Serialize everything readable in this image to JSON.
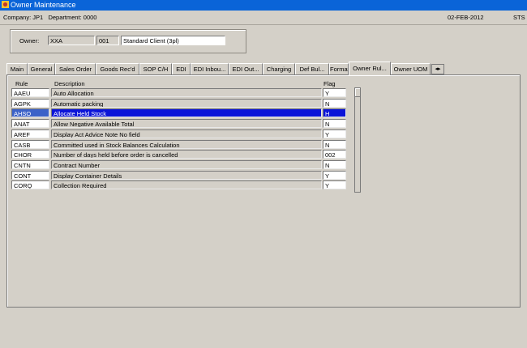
{
  "window": {
    "title": "Owner Maintenance",
    "icon": "oracle-forms-app-icon"
  },
  "infobar": {
    "company": "Company: JP1   Department: 0000",
    "date": "02-FEB-2012",
    "user": "STS"
  },
  "owner": {
    "label": "Owner:",
    "code": "XXA",
    "number": "001",
    "name": "Standard Client (3pl)"
  },
  "tabs": [
    {
      "label": "Main"
    },
    {
      "label": "General"
    },
    {
      "label": "Sales Order"
    },
    {
      "label": "Goods Rec'd"
    },
    {
      "label": "SOP C/H"
    },
    {
      "label": "EDI"
    },
    {
      "label": "EDI Inbou..."
    },
    {
      "label": "EDI Out..."
    },
    {
      "label": "Charging"
    },
    {
      "label": "Def Bul..."
    },
    {
      "label": "Format"
    },
    {
      "label": "Owner Rul..."
    },
    {
      "label": "Owner UOM"
    }
  ],
  "active_tab": "Owner Rul...",
  "tab_scroll_glyph": "◂▸",
  "grid": {
    "columns": {
      "rule": "Rule",
      "description": "Description",
      "flag": "Flag"
    },
    "rows": [
      {
        "rule": "AAEU",
        "description": "Auto Allocation",
        "flag": "Y"
      },
      {
        "rule": "AGPK",
        "description": "Automatic packing",
        "flag": "N"
      },
      {
        "rule": "AHSO",
        "description": "Allocate Held Stock",
        "flag": "H"
      },
      {
        "rule": "ANAT",
        "description": "Allow Negative Available Total",
        "flag": "N"
      },
      {
        "rule": "AREF",
        "description": "Display Act Advice Note No field",
        "flag": "Y"
      },
      {
        "rule": "CASB",
        "description": "Committed used in Stock Balances Calculation",
        "flag": "N"
      },
      {
        "rule": "CHOR",
        "description": "Number of days held before order is cancelled",
        "flag": "002"
      },
      {
        "rule": "CNTN",
        "description": "Contract Number",
        "flag": "N"
      },
      {
        "rule": "CONT",
        "description": "Display Container Details",
        "flag": "Y"
      },
      {
        "rule": "CORQ",
        "description": "Collection Required",
        "flag": "Y"
      }
    ],
    "selected_rule": "AHSO"
  }
}
